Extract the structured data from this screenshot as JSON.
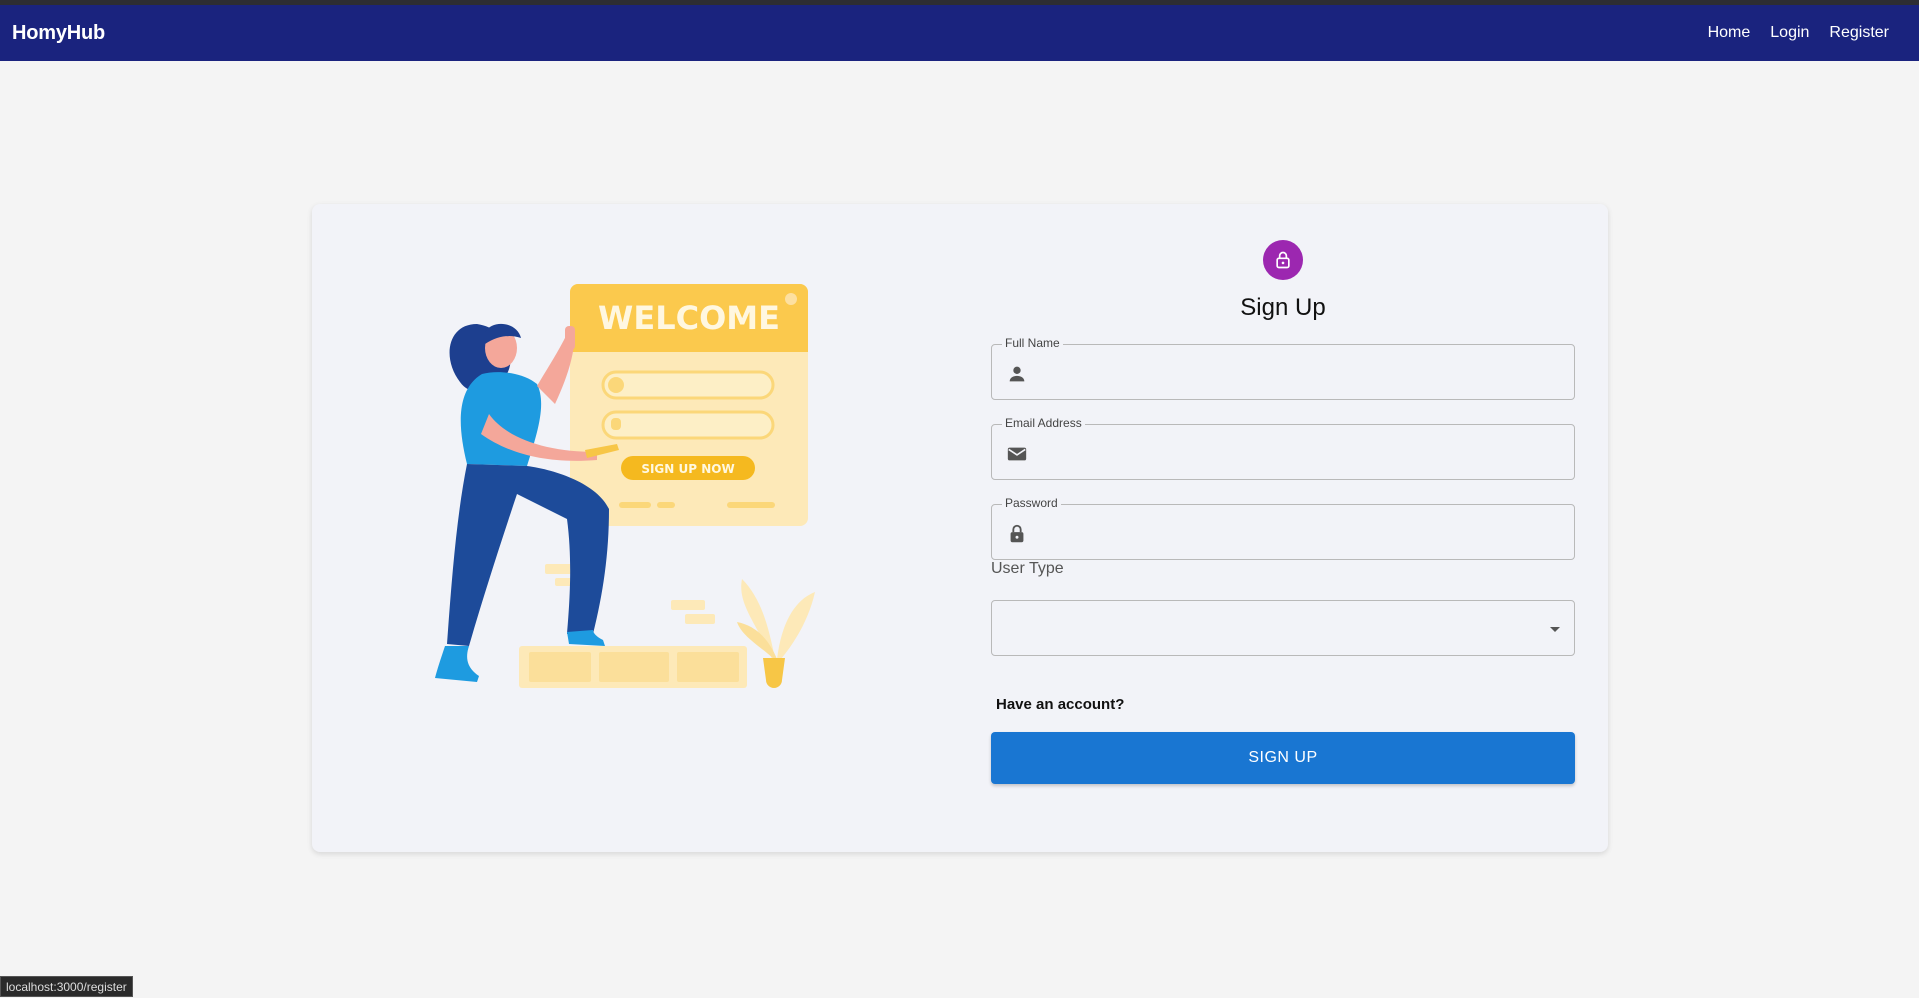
{
  "app": {
    "brand": "HomyHub"
  },
  "nav": {
    "home": "Home",
    "login": "Login",
    "register": "Register"
  },
  "illustration": {
    "welcome": "WELCOME",
    "cta": "SIGN UP NOW"
  },
  "form": {
    "title": "Sign Up",
    "full_name_label": "Full Name",
    "email_label": "Email Address",
    "password_label": "Password",
    "user_type_label": "User Type",
    "have_account": "Have an account?",
    "submit": "SIGN UP"
  },
  "status": {
    "url": "localhost:3000/register"
  },
  "colors": {
    "navbar": "#1a237e",
    "lock_avatar": "#9c27b0",
    "primary_button": "#1976d2"
  }
}
